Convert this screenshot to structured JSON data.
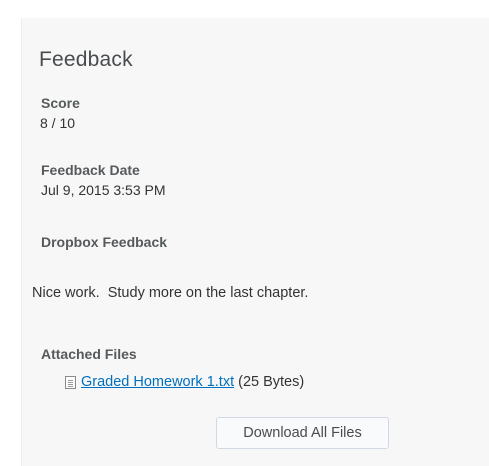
{
  "feedback": {
    "title": "Feedback",
    "score_label": "Score",
    "score_value": "8 / 10",
    "date_label": "Feedback Date",
    "date_value": "Jul 9, 2015 3:53 PM",
    "dropbox_label": "Dropbox Feedback",
    "comment": "Nice work.  Study more on the last chapter.",
    "attached_label": "Attached Files",
    "file": {
      "icon": "text-file-icon",
      "name": "Graded Homework 1.txt",
      "size": "(25 Bytes)"
    },
    "download_all_label": "Download All Files"
  },
  "colors": {
    "panel_background": "#f7f7f7",
    "link": "#006fbf",
    "label_text": "#565a5c"
  }
}
